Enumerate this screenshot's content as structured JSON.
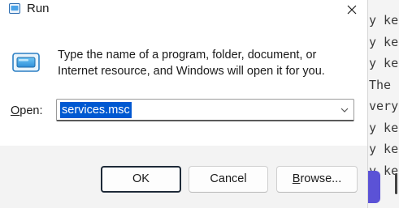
{
  "dialog": {
    "title": "Run",
    "description": "Type the name of a program, folder, document, or Internet resource, and Windows will open it for you.",
    "open_label_mnemonic": "O",
    "open_label_rest": "pen:",
    "open_value": "services.msc",
    "ok_label": "OK",
    "cancel_label": "Cancel",
    "browse_label_mnemonic": "B",
    "browse_label_rest": "rowse...",
    "icons": {
      "title": "run-icon",
      "close": "close-icon",
      "main": "run-icon",
      "dropdown": "chevron-down-icon"
    },
    "colors": {
      "selection": "#0058d1",
      "footer": "#f3f3f3"
    }
  },
  "background_window": {
    "lines": [
      "y ke",
      "y ke",
      "y ke",
      "The",
      "very",
      "y ke",
      "y ke",
      "y ke"
    ]
  }
}
